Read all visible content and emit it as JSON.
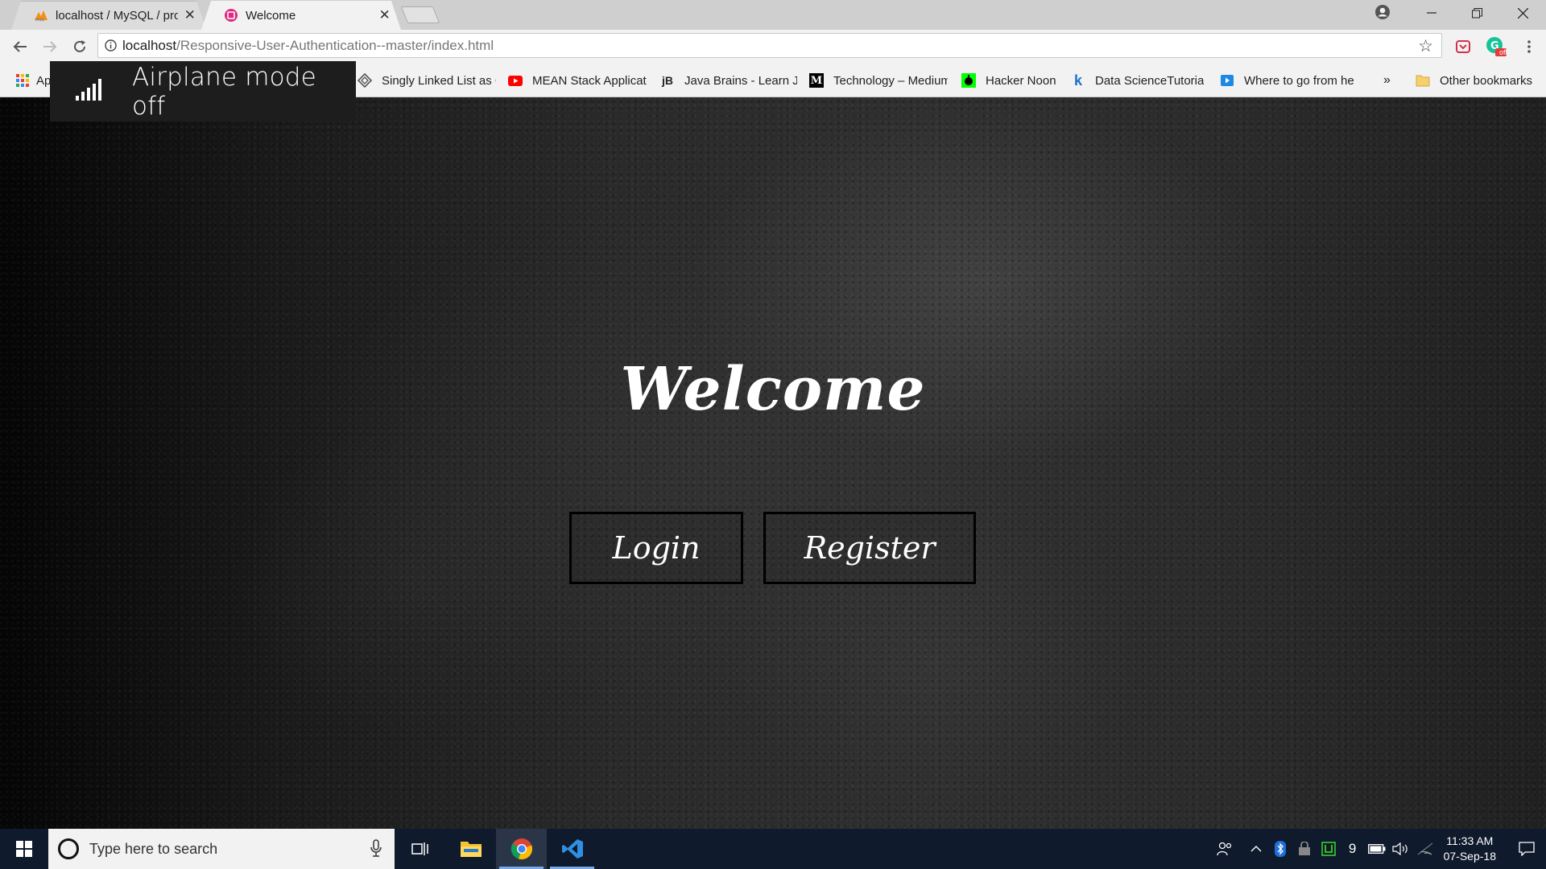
{
  "tabs": [
    {
      "title": "localhost / MySQL / proje",
      "active": false
    },
    {
      "title": "Welcome",
      "active": true
    }
  ],
  "omnibox": {
    "host": "localhost",
    "path": "/Responsive-User-Authentication--master/index.html"
  },
  "extensions": {
    "grammarly_badge": "off"
  },
  "bookmarks": [
    {
      "label": "Ap",
      "icon": "apps-grid-icon"
    },
    {
      "label": "Singly Linked List as C",
      "icon": "diamond-icon"
    },
    {
      "label": "MEAN Stack Applicat",
      "icon": "youtube-icon"
    },
    {
      "label": "Java Brains - Learn Ja",
      "icon": "jb-icon",
      "icon_text": "jB"
    },
    {
      "label": "Technology – Medium",
      "icon": "medium-icon",
      "icon_text": "M"
    },
    {
      "label": "Hacker Noon",
      "icon": "hackernoon-icon"
    },
    {
      "label": "Data ScienceTutorial",
      "icon": "kdnuggets-icon",
      "icon_text": "k"
    },
    {
      "label": "Where to go from he",
      "icon": "play-icon"
    },
    {
      "label": "»",
      "icon": ""
    },
    {
      "label": "Other bookmarks",
      "icon": "folder-icon"
    }
  ],
  "toast": {
    "text": "Airplane mode off"
  },
  "page": {
    "heading": "Welcome",
    "login_label": "Login",
    "register_label": "Register"
  },
  "taskbar": {
    "search_placeholder": "Type here to search",
    "battery_count": "9",
    "time": "11:33 AM",
    "date": "07-Sep-18"
  }
}
